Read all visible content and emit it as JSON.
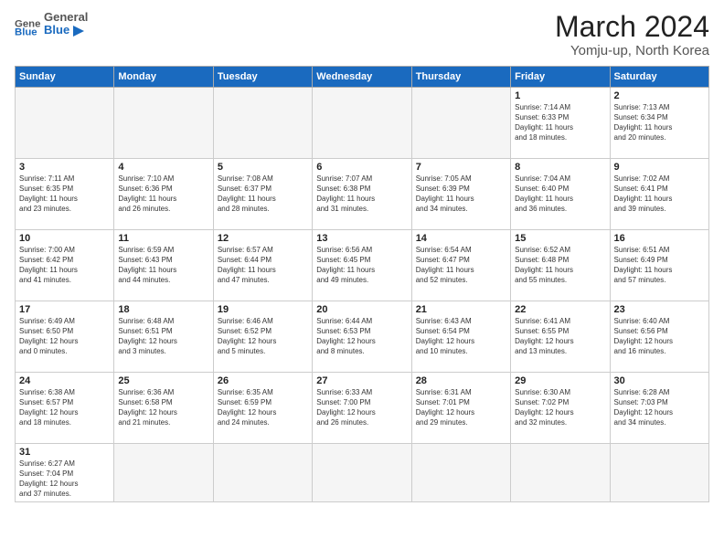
{
  "logo": {
    "text_general": "General",
    "text_blue": "Blue"
  },
  "header": {
    "month": "March 2024",
    "location": "Yomju-up, North Korea"
  },
  "weekdays": [
    "Sunday",
    "Monday",
    "Tuesday",
    "Wednesday",
    "Thursday",
    "Friday",
    "Saturday"
  ],
  "weeks": [
    [
      {
        "day": "",
        "info": ""
      },
      {
        "day": "",
        "info": ""
      },
      {
        "day": "",
        "info": ""
      },
      {
        "day": "",
        "info": ""
      },
      {
        "day": "",
        "info": ""
      },
      {
        "day": "1",
        "info": "Sunrise: 7:14 AM\nSunset: 6:33 PM\nDaylight: 11 hours\nand 18 minutes."
      },
      {
        "day": "2",
        "info": "Sunrise: 7:13 AM\nSunset: 6:34 PM\nDaylight: 11 hours\nand 20 minutes."
      }
    ],
    [
      {
        "day": "3",
        "info": "Sunrise: 7:11 AM\nSunset: 6:35 PM\nDaylight: 11 hours\nand 23 minutes."
      },
      {
        "day": "4",
        "info": "Sunrise: 7:10 AM\nSunset: 6:36 PM\nDaylight: 11 hours\nand 26 minutes."
      },
      {
        "day": "5",
        "info": "Sunrise: 7:08 AM\nSunset: 6:37 PM\nDaylight: 11 hours\nand 28 minutes."
      },
      {
        "day": "6",
        "info": "Sunrise: 7:07 AM\nSunset: 6:38 PM\nDaylight: 11 hours\nand 31 minutes."
      },
      {
        "day": "7",
        "info": "Sunrise: 7:05 AM\nSunset: 6:39 PM\nDaylight: 11 hours\nand 34 minutes."
      },
      {
        "day": "8",
        "info": "Sunrise: 7:04 AM\nSunset: 6:40 PM\nDaylight: 11 hours\nand 36 minutes."
      },
      {
        "day": "9",
        "info": "Sunrise: 7:02 AM\nSunset: 6:41 PM\nDaylight: 11 hours\nand 39 minutes."
      }
    ],
    [
      {
        "day": "10",
        "info": "Sunrise: 7:00 AM\nSunset: 6:42 PM\nDaylight: 11 hours\nand 41 minutes."
      },
      {
        "day": "11",
        "info": "Sunrise: 6:59 AM\nSunset: 6:43 PM\nDaylight: 11 hours\nand 44 minutes."
      },
      {
        "day": "12",
        "info": "Sunrise: 6:57 AM\nSunset: 6:44 PM\nDaylight: 11 hours\nand 47 minutes."
      },
      {
        "day": "13",
        "info": "Sunrise: 6:56 AM\nSunset: 6:45 PM\nDaylight: 11 hours\nand 49 minutes."
      },
      {
        "day": "14",
        "info": "Sunrise: 6:54 AM\nSunset: 6:47 PM\nDaylight: 11 hours\nand 52 minutes."
      },
      {
        "day": "15",
        "info": "Sunrise: 6:52 AM\nSunset: 6:48 PM\nDaylight: 11 hours\nand 55 minutes."
      },
      {
        "day": "16",
        "info": "Sunrise: 6:51 AM\nSunset: 6:49 PM\nDaylight: 11 hours\nand 57 minutes."
      }
    ],
    [
      {
        "day": "17",
        "info": "Sunrise: 6:49 AM\nSunset: 6:50 PM\nDaylight: 12 hours\nand 0 minutes."
      },
      {
        "day": "18",
        "info": "Sunrise: 6:48 AM\nSunset: 6:51 PM\nDaylight: 12 hours\nand 3 minutes."
      },
      {
        "day": "19",
        "info": "Sunrise: 6:46 AM\nSunset: 6:52 PM\nDaylight: 12 hours\nand 5 minutes."
      },
      {
        "day": "20",
        "info": "Sunrise: 6:44 AM\nSunset: 6:53 PM\nDaylight: 12 hours\nand 8 minutes."
      },
      {
        "day": "21",
        "info": "Sunrise: 6:43 AM\nSunset: 6:54 PM\nDaylight: 12 hours\nand 10 minutes."
      },
      {
        "day": "22",
        "info": "Sunrise: 6:41 AM\nSunset: 6:55 PM\nDaylight: 12 hours\nand 13 minutes."
      },
      {
        "day": "23",
        "info": "Sunrise: 6:40 AM\nSunset: 6:56 PM\nDaylight: 12 hours\nand 16 minutes."
      }
    ],
    [
      {
        "day": "24",
        "info": "Sunrise: 6:38 AM\nSunset: 6:57 PM\nDaylight: 12 hours\nand 18 minutes."
      },
      {
        "day": "25",
        "info": "Sunrise: 6:36 AM\nSunset: 6:58 PM\nDaylight: 12 hours\nand 21 minutes."
      },
      {
        "day": "26",
        "info": "Sunrise: 6:35 AM\nSunset: 6:59 PM\nDaylight: 12 hours\nand 24 minutes."
      },
      {
        "day": "27",
        "info": "Sunrise: 6:33 AM\nSunset: 7:00 PM\nDaylight: 12 hours\nand 26 minutes."
      },
      {
        "day": "28",
        "info": "Sunrise: 6:31 AM\nSunset: 7:01 PM\nDaylight: 12 hours\nand 29 minutes."
      },
      {
        "day": "29",
        "info": "Sunrise: 6:30 AM\nSunset: 7:02 PM\nDaylight: 12 hours\nand 32 minutes."
      },
      {
        "day": "30",
        "info": "Sunrise: 6:28 AM\nSunset: 7:03 PM\nDaylight: 12 hours\nand 34 minutes."
      }
    ],
    [
      {
        "day": "31",
        "info": "Sunrise: 6:27 AM\nSunset: 7:04 PM\nDaylight: 12 hours\nand 37 minutes."
      },
      {
        "day": "",
        "info": ""
      },
      {
        "day": "",
        "info": ""
      },
      {
        "day": "",
        "info": ""
      },
      {
        "day": "",
        "info": ""
      },
      {
        "day": "",
        "info": ""
      },
      {
        "day": "",
        "info": ""
      }
    ]
  ]
}
